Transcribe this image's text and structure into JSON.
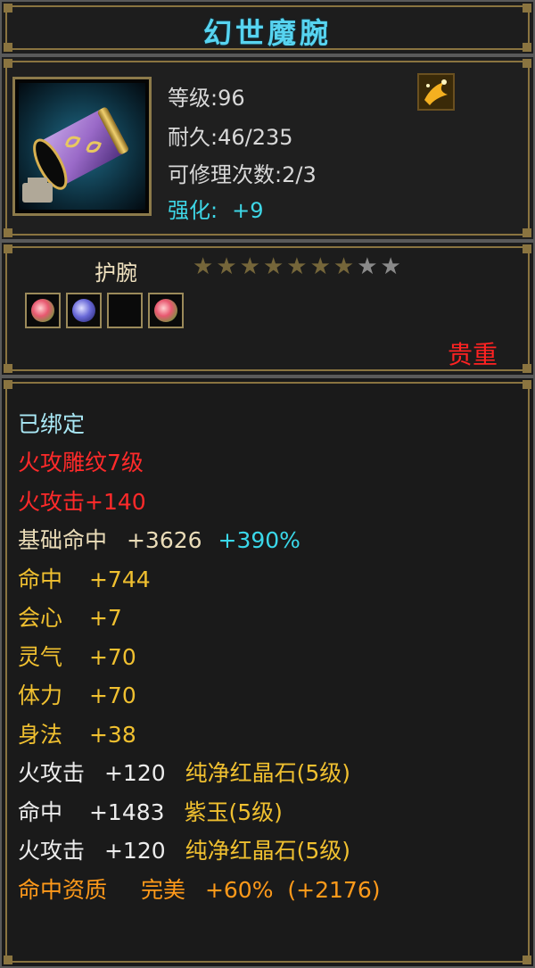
{
  "title": "幻世魔腕",
  "info": {
    "level": "等级:96",
    "durability": "耐久:46/235",
    "repairs": "可修理次数:2/3",
    "enhance_label": "强化:",
    "enhance_value": "+9"
  },
  "item_type": "护腕",
  "stars": {
    "filled": 7,
    "total": 9
  },
  "gem_slots": [
    "red-gem",
    "purple-gem",
    "empty",
    "red-gem"
  ],
  "rarity": "贵重",
  "attributes": {
    "bound": "已绑定",
    "engrave": "火攻雕纹7级",
    "fire_attack": "火攻击+140",
    "base_hit_label": "基础命中",
    "base_hit_value": "+3626",
    "base_hit_pct": "+390%",
    "hit_label": "命中",
    "hit_value": "+744",
    "crit_label": "会心",
    "crit_value": "+7",
    "spirit_label": "灵气",
    "spirit_value": "+70",
    "stamina_label": "体力",
    "stamina_value": "+70",
    "agility_label": "身法",
    "agility_value": "+38",
    "gem1_label": "火攻击",
    "gem1_value": "+120",
    "gem1_name": "纯净红晶石(5级)",
    "gem2_label": "命中",
    "gem2_value": "+1483",
    "gem2_name": "紫玉(5级)",
    "gem3_label": "火攻击",
    "gem3_value": "+120",
    "gem3_name": "纯净红晶石(5级)",
    "quality_label": "命中资质",
    "quality_grade": "完美",
    "quality_pct": "+60%",
    "quality_bonus": "(+2176)"
  },
  "colors": {
    "title": "#57d4f0",
    "rarity": "#ff2222",
    "gold_text": "#f0c030",
    "orange_text": "#ff9a1a",
    "cyan_text": "#3ad8ea",
    "red_text": "#ff2a2a"
  }
}
